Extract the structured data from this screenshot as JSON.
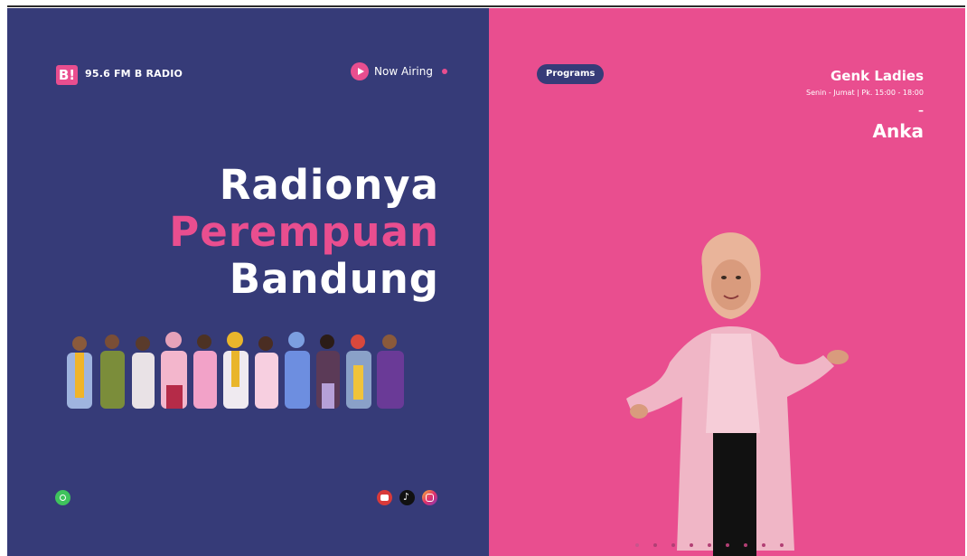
{
  "header": {
    "logo_text": "B!",
    "brand": "95.6 FM B RADIO",
    "now_airing": "Now Airing"
  },
  "hero": {
    "line1": "Radionya",
    "line2": "Perempuan",
    "line3": "Bandung"
  },
  "social": {
    "whatsapp": "whatsapp-icon",
    "youtube": "youtube-icon",
    "tiktok": "tiktok-icon",
    "instagram": "instagram-icon"
  },
  "program": {
    "button": "Programs",
    "title": "Genk Ladies",
    "schedule": "Senin - Jumat | Pk. 15:00 - 18:00",
    "separator": "–",
    "host": "Anka"
  },
  "colors": {
    "navy": "#363b78",
    "pink": "#e94e8f"
  },
  "carousel": {
    "count": 9,
    "active_index": 0
  }
}
